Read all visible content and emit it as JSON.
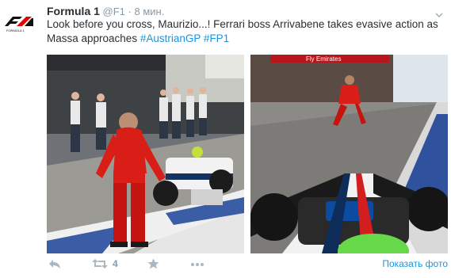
{
  "tweet": {
    "author_name": "Formula 1",
    "handle": "@F1",
    "separator": "·",
    "time": "8 мин.",
    "text_main": "Look before you cross, Maurizio...! Ferrari boss Arrivabene takes evasive action as Massa approaches ",
    "hashtags": [
      "#AustrianGP",
      "#FP1"
    ],
    "avatar_icon": "f1-logo-icon",
    "caret_icon": "chevron-down-icon"
  },
  "photos": {
    "left_alt_name": "pitlane-photo",
    "right_alt_name": "onboard-photo",
    "right_banner_text": "Fly Emirates"
  },
  "actions": {
    "reply_icon": "reply-icon",
    "retweet_icon": "retweet-icon",
    "retweet_count": "4",
    "favorite_icon": "star-icon",
    "more_icon": "more-icon",
    "show_photo": "Показать фото"
  },
  "colors": {
    "link": "#1b95e0",
    "meta": "#8899a6",
    "icon": "#aab8c2",
    "f1_red": "#e10600"
  }
}
